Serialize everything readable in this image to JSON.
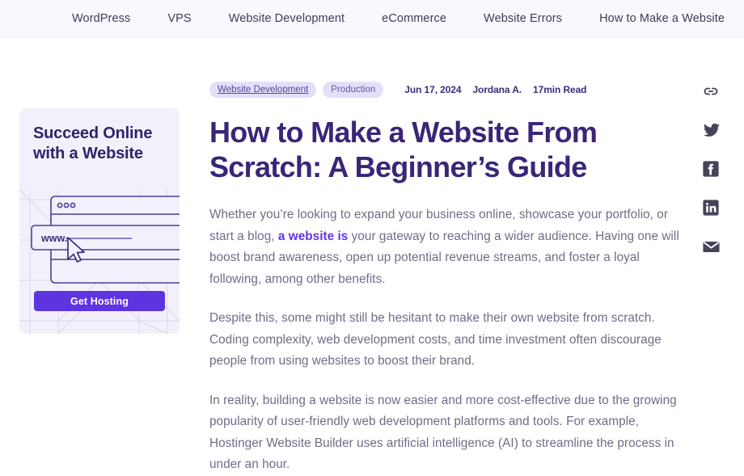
{
  "nav": {
    "items": [
      {
        "label": "WordPress"
      },
      {
        "label": "VPS"
      },
      {
        "label": "Website Development"
      },
      {
        "label": "eCommerce"
      },
      {
        "label": "Website Errors"
      },
      {
        "label": "How to Make a Website"
      }
    ]
  },
  "ad": {
    "title": "Succeed Online with a Website",
    "url_text": "www.",
    "cta_label": "Get Hosting",
    "background": "#f2f1fb",
    "accent": "#5c34e0",
    "title_color": "#2f236b"
  },
  "article": {
    "tags": [
      {
        "label": "Website Development",
        "is_link": true
      },
      {
        "label": "Production",
        "is_link": false
      }
    ],
    "date": "Jun 17, 2024",
    "author": "Jordana A.",
    "read_time": "17min Read",
    "title": "How to Make a Website From Scratch: A Beginner’s Guide",
    "title_color": "#3a2579",
    "paragraphs": [
      {
        "before": "Whether you’re looking to expand your business online, showcase your portfolio, or start a blog, ",
        "link": "a website is",
        "after": " your gateway to reaching a wider audience. Having one will boost brand awareness, open up potential revenue streams, and foster a loyal following, among other benefits."
      },
      {
        "before": "Despite this, some might still be hesitant to make their own website from scratch. Coding complexity, web development costs, and time investment often discourage people from using websites to boost their brand.",
        "link": "",
        "after": ""
      },
      {
        "before": "In reality, building a website is now easier and more cost-effective due to the growing popularity of user-friendly web development platforms and tools. For example, Hostinger Website Builder uses artificial intelligence (AI) to streamline the process in under an hour.",
        "link": "",
        "after": ""
      }
    ],
    "link_color": "#6236e0"
  },
  "share": {
    "items": [
      {
        "icon": "link-icon",
        "label": "Copy link"
      },
      {
        "icon": "twitter-icon",
        "label": "Share on Twitter"
      },
      {
        "icon": "facebook-icon",
        "label": "Share on Facebook"
      },
      {
        "icon": "linkedin-icon",
        "label": "Share on LinkedIn"
      },
      {
        "icon": "email-icon",
        "label": "Share by email"
      }
    ],
    "color": "#474459"
  }
}
